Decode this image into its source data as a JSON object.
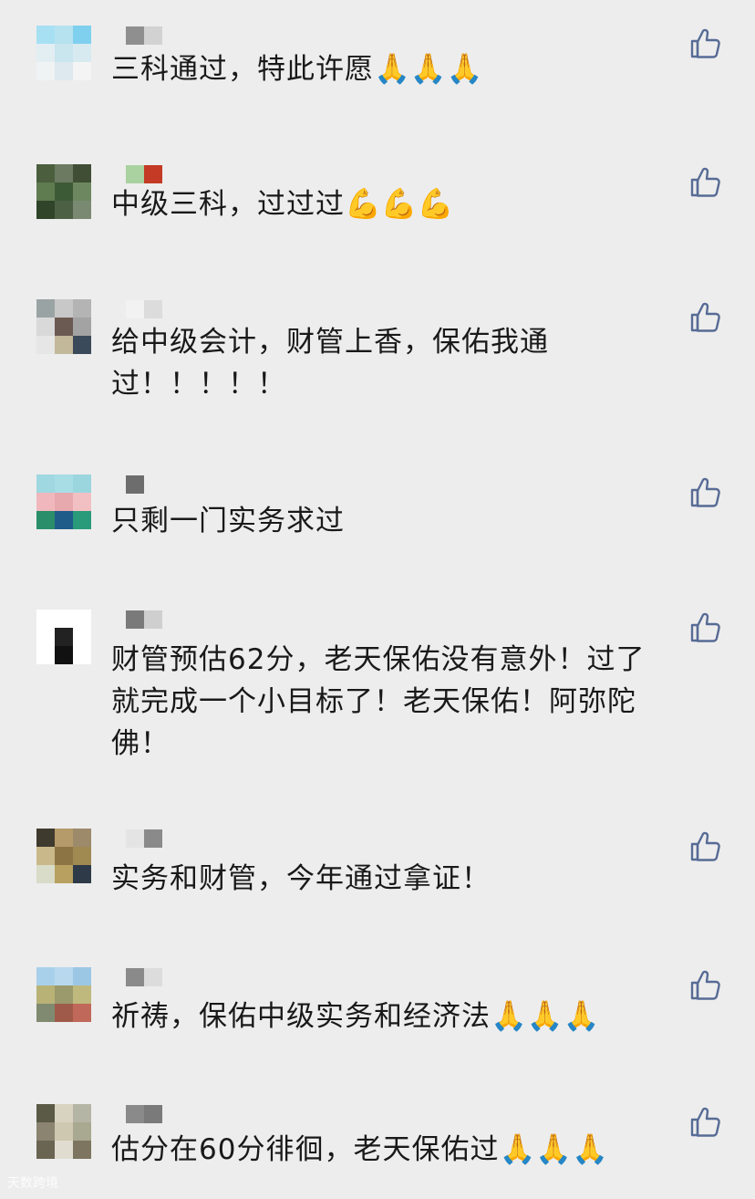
{
  "comments": [
    {
      "text": "三科通过，特此许愿",
      "emoji": "🙏🙏🙏",
      "avatar": [
        "#a7e0f3",
        "#b6e2ef",
        "#7fd0ef",
        "#e3eef2",
        "#c9e5ee",
        "#d6eaf0",
        "#f0f3f4",
        "#dde9ee",
        "#f4f4f4"
      ],
      "nick": [
        "#8f8f8f",
        "#d2d2d2"
      ]
    },
    {
      "text": "中级三科，过过过",
      "emoji": "💪💪💪",
      "avatar": [
        "#4b5f3e",
        "#6c7a61",
        "#3f4e35",
        "#5f7b50",
        "#3d5a36",
        "#6d8860",
        "#2f4428",
        "#4c6143",
        "#7a8a72"
      ],
      "nick": [
        "#a9d2a0",
        "#c43a25"
      ]
    },
    {
      "text": "给中级会计，财管上香，保佑我通过！！！！！",
      "emoji": "",
      "avatar": [
        "#9aa3a3",
        "#c8c8c8",
        "#b4b4b4",
        "#d9d9d9",
        "#6b5a52",
        "#a3a3a3",
        "#e6e6e6",
        "#c2b89a",
        "#3a4a5a"
      ],
      "nick": [
        "#f2f2f2",
        "#dcdcdc"
      ]
    },
    {
      "text": "只剩一门实务求过",
      "emoji": "",
      "avatar": [
        "#9fd8e0",
        "#a8dde6",
        "#9bd6df",
        "#f0b8bd",
        "#e8a9ae",
        "#f2c0c3",
        "#2b8e6b",
        "#1f5c8a",
        "#2a9b7a"
      ],
      "nick": [
        "#6d6d6d",
        "#ededed"
      ]
    },
    {
      "text": "财管预估62分，老天保佑没有意外！过了就完成一个小目标了！老天保佑！阿弥陀佛！",
      "emoji": "",
      "avatar": [
        "#ffffff",
        "#ffffff",
        "#ffffff",
        "#ffffff",
        "#222222",
        "#ffffff",
        "#ffffff",
        "#111111",
        "#ffffff"
      ],
      "nick": [
        "#7a7a7a",
        "#cfcfcf"
      ]
    },
    {
      "text": "实务和财管，今年通过拿证！",
      "emoji": "",
      "avatar": [
        "#3f3a2e",
        "#b59a6a",
        "#9c8a6a",
        "#c9b98a",
        "#8c7444",
        "#a08a52",
        "#d8dcc8",
        "#b7a060",
        "#2e3a48"
      ],
      "nick": [
        "#e4e4e4",
        "#8a8a8a"
      ]
    },
    {
      "text": "祈祷，保佑中级实务和经济法",
      "emoji": "🙏🙏🙏",
      "avatar": [
        "#a9d0ea",
        "#b8d8ee",
        "#9cc7e4",
        "#b8b276",
        "#9a9a6c",
        "#c0b97e",
        "#7f8a70",
        "#a05a4a",
        "#c0685a"
      ],
      "nick": [
        "#8a8a8a",
        "#dcdcdc"
      ]
    },
    {
      "text": "估分在60分徘徊，老天保佑过",
      "emoji": "🙏🙏🙏",
      "avatar": [
        "#5a5a46",
        "#d8d2c0",
        "#b5b5a5",
        "#8a8470",
        "#cfc8b0",
        "#a9a890",
        "#6a6452",
        "#e0dcd0",
        "#7d7560"
      ],
      "nick": [
        "#8a8a8a",
        "#7a7a7a"
      ]
    }
  ],
  "icons": {
    "like": "thumbs-up-icon"
  },
  "watermark": "天数跨境"
}
